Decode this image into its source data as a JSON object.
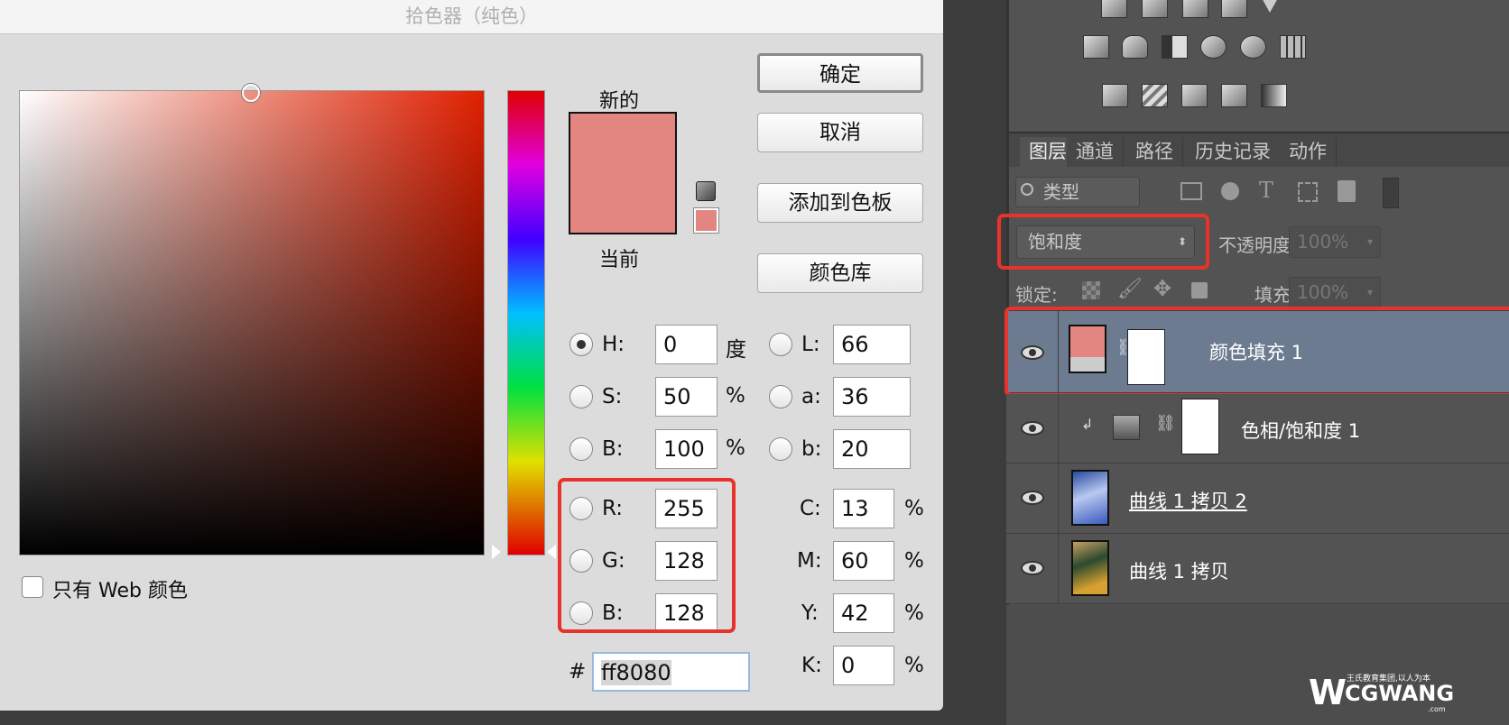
{
  "dialog": {
    "title": "拾色器（纯色）",
    "new_label": "新的",
    "current_label": "当前",
    "new_color": "#e38580",
    "current_color": "#e38580",
    "buttons": {
      "ok": "确定",
      "cancel": "取消",
      "add_to_swatches": "添加到色板",
      "color_libraries": "颜色库"
    },
    "web_only_label": "只有 Web 颜色",
    "fields": {
      "H": {
        "label": "H:",
        "value": "0",
        "unit": "度"
      },
      "S": {
        "label": "S:",
        "value": "50",
        "unit": "%"
      },
      "B": {
        "label": "B:",
        "value": "100",
        "unit": "%"
      },
      "R": {
        "label": "R:",
        "value": "255"
      },
      "G": {
        "label": "G:",
        "value": "128"
      },
      "Bl": {
        "label": "B:",
        "value": "128"
      },
      "L": {
        "label": "L:",
        "value": "66"
      },
      "a": {
        "label": "a:",
        "value": "36"
      },
      "b": {
        "label": "b:",
        "value": "20"
      },
      "C": {
        "label": "C:",
        "value": "13",
        "unit": "%"
      },
      "M": {
        "label": "M:",
        "value": "60",
        "unit": "%"
      },
      "Y": {
        "label": "Y:",
        "value": "42",
        "unit": "%"
      },
      "K": {
        "label": "K:",
        "value": "0",
        "unit": "%"
      }
    },
    "hex_label": "#",
    "hex_value": "ff8080"
  },
  "panel": {
    "tabs": [
      "图层",
      "通道",
      "路径",
      "历史记录",
      "动作"
    ],
    "filter_label": "类型",
    "blend_mode": "饱和度",
    "opacity_label": "不透明度:",
    "opacity_value": "100%",
    "lock_label": "锁定:",
    "fill_label": "填充:",
    "fill_value": "100%",
    "layers": [
      {
        "name": "颜色填充 1",
        "selected": true
      },
      {
        "name": "色相/饱和度 1",
        "clipped": true
      },
      {
        "name": "曲线 1 拷贝 2"
      },
      {
        "name": "曲线 1 拷贝"
      }
    ]
  },
  "watermark": {
    "brand": "CGWANG",
    "tagline": "王氏教育集团,以人为本",
    "domain": ".com"
  },
  "colors": {
    "highlight": "#e8322b",
    "selected_layer": "#6c7b90"
  }
}
